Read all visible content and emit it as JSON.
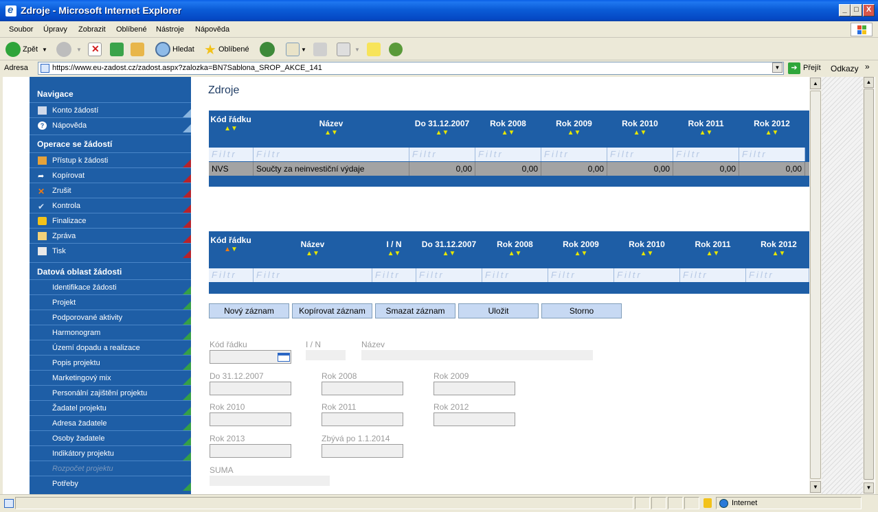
{
  "window": {
    "title": "Zdroje - Microsoft Internet Explorer",
    "minimize": "_",
    "maximize": "□",
    "close": "X"
  },
  "menu": [
    "Soubor",
    "Úpravy",
    "Zobrazit",
    "Oblíbené",
    "Nástroje",
    "Nápověda"
  ],
  "toolbar": {
    "back": "Zpět",
    "search": "Hledat",
    "favorites": "Oblíbené"
  },
  "address": {
    "label": "Adresa",
    "url": "https://www.eu-zadost.cz/zadost.aspx?zalozka=BN7Sablona_SROP_AKCE_141",
    "go": "Přejít",
    "links": "Odkazy"
  },
  "sidebar": {
    "sections": [
      "Navigace",
      "Operace se žádostí",
      "Datová oblast žádosti"
    ],
    "nav": [
      "Konto žádostí",
      "Nápověda"
    ],
    "operations": [
      "Přístup k žádosti",
      "Kopírovat",
      "Zrušit",
      "Kontrola",
      "Finalizace",
      "Zpráva",
      "Tisk"
    ],
    "data": [
      "Identifikace žádosti",
      "Projekt",
      "Podporované aktivity",
      "Harmonogram",
      "Území dopadu a realizace",
      "Popis projektu",
      "Marketingový mix",
      "Personální zajištění projektu",
      "Žadatel projektu",
      "Adresa žadatele",
      "Osoby žadatele",
      "Indikátory projektu",
      "Rozpočet projektu",
      "Potřeby"
    ]
  },
  "page_title": "Zdroje",
  "grid1": {
    "columns": [
      "Kód řádku",
      "Název",
      "Do 31.12.2007",
      "Rok 2008",
      "Rok 2009",
      "Rok 2010",
      "Rok 2011",
      "Rok 2012"
    ],
    "filter_placeholder": "Filtr",
    "rows": [
      {
        "kod": "NVS",
        "nazev": "Součty za neinvestiční výdaje",
        "values": [
          "0,00",
          "0,00",
          "0,00",
          "0,00",
          "0,00",
          "0,00"
        ]
      }
    ]
  },
  "grid2": {
    "columns": [
      "Kód řádku",
      "Název",
      "I / N",
      "Do 31.12.2007",
      "Rok 2008",
      "Rok 2009",
      "Rok 2010",
      "Rok 2011",
      "Rok 2012"
    ],
    "filter_placeholder": "Filtr"
  },
  "buttons": {
    "new": "Nový záznam",
    "copy": "Kopírovat záznam",
    "delete": "Smazat záznam",
    "save": "Uložit",
    "cancel": "Storno"
  },
  "form": {
    "kod_radku": "Kód řádku",
    "in": "I / N",
    "nazev": "Název",
    "do2007": "Do 31.12.2007",
    "rok2008": "Rok 2008",
    "rok2009": "Rok 2009",
    "rok2010": "Rok 2010",
    "rok2011": "Rok 2011",
    "rok2012": "Rok 2012",
    "rok2013": "Rok 2013",
    "zbyva": "Zbývá po 1.1.2014",
    "suma": "SUMA"
  },
  "status": {
    "zone": "Internet"
  }
}
